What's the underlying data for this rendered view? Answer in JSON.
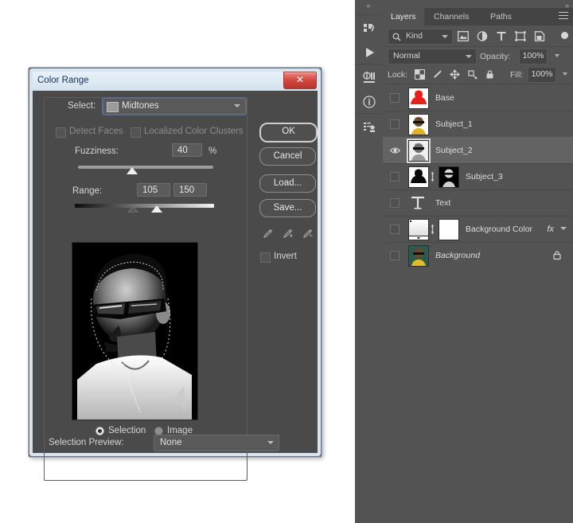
{
  "dialog": {
    "title": "Color Range",
    "close_label": "✕",
    "select_label": "Select:",
    "select_value": "Midtones",
    "detect_faces_label": "Detect Faces",
    "localized_clusters_label": "Localized Color Clusters",
    "fuzziness_label": "Fuzziness:",
    "fuzziness_value": "40",
    "fuzziness_unit": "%",
    "range_label": "Range:",
    "range_min_value": "105",
    "range_max_value": "150",
    "preview_mode_selection": "Selection",
    "preview_mode_image": "Image",
    "selection_preview_label": "Selection Preview:",
    "selection_preview_value": "None",
    "buttons": {
      "ok": "OK",
      "cancel": "Cancel",
      "load": "Load...",
      "save": "Save..."
    },
    "invert_label": "Invert",
    "eyedroppers": [
      "eyedropper",
      "eyedropper-add",
      "eyedropper-subtract"
    ]
  },
  "panel": {
    "expand_left_icon": "«",
    "expand_right_icon": "»",
    "tabs": [
      {
        "label": "Layers",
        "active": true
      },
      {
        "label": "Channels",
        "active": false
      },
      {
        "label": "Paths",
        "active": false
      }
    ],
    "filter": {
      "kind_label": "Kind",
      "icons": [
        "pixel-layer-filter-icon",
        "adjustment-layer-filter-icon",
        "type-layer-filter-icon",
        "shape-layer-filter-icon",
        "smart-object-filter-icon"
      ]
    },
    "blend_mode": "Normal",
    "opacity_label": "Opacity:",
    "opacity_value": "100%",
    "lock_label": "Lock:",
    "lock_icons": [
      "lock-transparency-icon",
      "lock-image-icon",
      "lock-position-icon",
      "lock-artboard-icon",
      "lock-all-icon"
    ],
    "fill_label": "Fill:",
    "fill_value": "100%",
    "layers": [
      {
        "name": "Base",
        "visible": false,
        "selected": false,
        "thumb": "red-silhouette",
        "italic": false,
        "locked": false,
        "has_mask": false,
        "fx": false,
        "type": "image"
      },
      {
        "name": "Subject_1",
        "visible": false,
        "selected": false,
        "thumb": "portrait-yellow",
        "italic": false,
        "locked": false,
        "has_mask": false,
        "fx": false,
        "type": "image"
      },
      {
        "name": "Subject_2",
        "visible": true,
        "selected": true,
        "thumb": "portrait-gray",
        "italic": false,
        "locked": false,
        "has_mask": false,
        "fx": false,
        "type": "image"
      },
      {
        "name": "Subject_3",
        "visible": false,
        "selected": false,
        "thumb": "black-silhouette",
        "italic": false,
        "locked": false,
        "has_mask": true,
        "fx": false,
        "type": "image"
      },
      {
        "name": "Text",
        "visible": false,
        "selected": false,
        "thumb": "type-T",
        "italic": false,
        "locked": false,
        "has_mask": false,
        "fx": false,
        "type": "type"
      },
      {
        "name": "Background Color",
        "visible": false,
        "selected": false,
        "thumb": "gradient-fill",
        "italic": false,
        "locked": false,
        "has_mask": true,
        "fx": true,
        "type": "fill"
      },
      {
        "name": "Background",
        "visible": false,
        "selected": false,
        "thumb": "portrait-color",
        "italic": true,
        "locked": true,
        "has_mask": false,
        "fx": false,
        "type": "image"
      }
    ],
    "rail_icons": [
      "libraries-icon",
      "play-icon",
      "adjustments-icon",
      "info-icon",
      "layer-comps-icon"
    ]
  }
}
